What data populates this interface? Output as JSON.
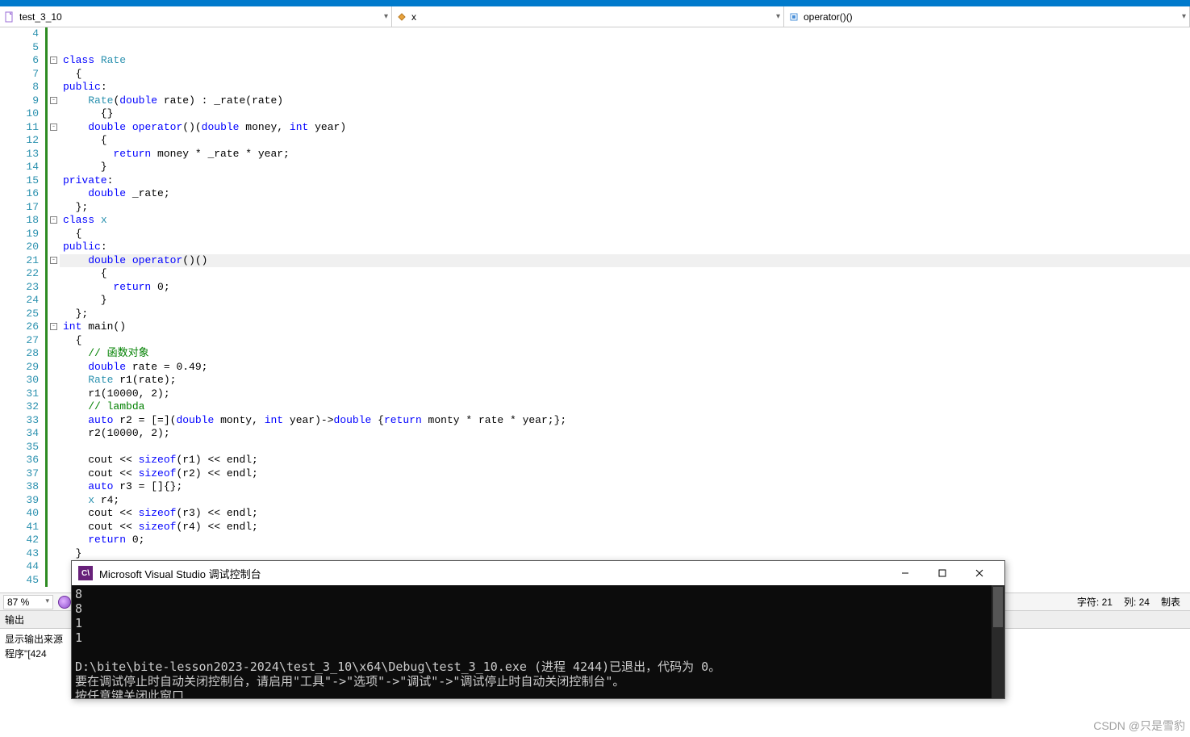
{
  "nav": {
    "scope1": "test_3_10",
    "scope2": "x",
    "scope3": "operator()()"
  },
  "editor": {
    "first_line": 4,
    "last_line": 45,
    "current_line": 21,
    "fold_lines": [
      6,
      9,
      11,
      18,
      21,
      26
    ],
    "change_bar_start": 4,
    "change_bar_end": 45,
    "code": {
      "4": [],
      "5": [],
      "6": [
        [
          "kw",
          "class"
        ],
        [
          " "
        ],
        [
          "type",
          "Rate"
        ]
      ],
      "7": [
        [
          "  {"
        ]
      ],
      "8": [
        [
          "kw",
          "public"
        ],
        [
          ":"
        ]
      ],
      "9": [
        [
          "    "
        ],
        [
          "type",
          "Rate"
        ],
        [
          "("
        ],
        [
          "kw",
          "double"
        ],
        [
          " rate) : _rate(rate)"
        ]
      ],
      "10": [
        [
          "      {}"
        ]
      ],
      "11": [
        [
          "    "
        ],
        [
          "kw",
          "double"
        ],
        [
          " "
        ],
        [
          "kw",
          "operator"
        ],
        [
          "()("
        ],
        [
          "kw",
          "double"
        ],
        [
          " money, "
        ],
        [
          "kw",
          "int"
        ],
        [
          " year)"
        ]
      ],
      "12": [
        [
          "      {"
        ]
      ],
      "13": [
        [
          "        "
        ],
        [
          "kw",
          "return"
        ],
        [
          " money * _rate * year;"
        ]
      ],
      "14": [
        [
          "      }"
        ]
      ],
      "15": [
        [
          "kw",
          "private"
        ],
        [
          ":"
        ]
      ],
      "16": [
        [
          "    "
        ],
        [
          "kw",
          "double"
        ],
        [
          " _rate;"
        ]
      ],
      "17": [
        [
          "  };"
        ]
      ],
      "18": [
        [
          "kw",
          "class"
        ],
        [
          " "
        ],
        [
          "type",
          "x"
        ]
      ],
      "19": [
        [
          "  {"
        ]
      ],
      "20": [
        [
          "kw",
          "public"
        ],
        [
          ":"
        ]
      ],
      "21": [
        [
          "    "
        ],
        [
          "kw",
          "double"
        ],
        [
          " "
        ],
        [
          "kw",
          "operator"
        ],
        [
          "()()"
        ]
      ],
      "22": [
        [
          "      {"
        ]
      ],
      "23": [
        [
          "        "
        ],
        [
          "kw",
          "return"
        ],
        [
          " 0;"
        ]
      ],
      "24": [
        [
          "      }"
        ]
      ],
      "25": [
        [
          "  };"
        ]
      ],
      "26": [
        [
          "kw",
          "int"
        ],
        [
          " main()"
        ]
      ],
      "27": [
        [
          "  {"
        ]
      ],
      "28": [
        [
          "    "
        ],
        [
          "cm",
          "// 函数对象"
        ]
      ],
      "29": [
        [
          "    "
        ],
        [
          "kw",
          "double"
        ],
        [
          " rate = 0.49;"
        ]
      ],
      "30": [
        [
          "    "
        ],
        [
          "type",
          "Rate"
        ],
        [
          " r1(rate);"
        ]
      ],
      "31": [
        [
          "    r1(10000, 2);"
        ]
      ],
      "32": [
        [
          "    "
        ],
        [
          "cm",
          "// lambda"
        ]
      ],
      "33": [
        [
          "    "
        ],
        [
          "kw",
          "auto"
        ],
        [
          " r2 = [=]("
        ],
        [
          "kw",
          "double"
        ],
        [
          " monty, "
        ],
        [
          "kw",
          "int"
        ],
        [
          " year)->"
        ],
        [
          "kw",
          "double"
        ],
        [
          " {"
        ],
        [
          "kw",
          "return"
        ],
        [
          " monty * rate * year;};"
        ]
      ],
      "34": [
        [
          "    r2(10000, 2);"
        ]
      ],
      "35": [],
      "36": [
        [
          "    cout << "
        ],
        [
          "kw",
          "sizeof"
        ],
        [
          "(r1) << endl;"
        ]
      ],
      "37": [
        [
          "    cout << "
        ],
        [
          "kw",
          "sizeof"
        ],
        [
          "(r2) << endl;"
        ]
      ],
      "38": [
        [
          "    "
        ],
        [
          "kw",
          "auto"
        ],
        [
          " r3 = []{};"
        ]
      ],
      "39": [
        [
          "    "
        ],
        [
          "type",
          "x"
        ],
        [
          " r4;"
        ]
      ],
      "40": [
        [
          "    cout << "
        ],
        [
          "kw",
          "sizeof"
        ],
        [
          "(r3) << endl;"
        ]
      ],
      "41": [
        [
          "    cout << "
        ],
        [
          "kw",
          "sizeof"
        ],
        [
          "(r4) << endl;"
        ]
      ],
      "42": [
        [
          "    "
        ],
        [
          "kw",
          "return"
        ],
        [
          " 0;"
        ]
      ],
      "43": [
        [
          "  }"
        ]
      ],
      "44": [],
      "45": []
    }
  },
  "zoom": "87 %",
  "status": {
    "char_label": "字符:",
    "char_val": "21",
    "col_label": "列:",
    "col_val": "24",
    "tabs": "制表"
  },
  "output": {
    "title": "输出",
    "source_label": "显示输出来源",
    "log_line": "程序\"[424"
  },
  "console": {
    "title": "Microsoft Visual Studio 调试控制台",
    "lines": [
      "8",
      "8",
      "1",
      "1",
      "",
      "D:\\bite\\bite-lesson2023-2024\\test_3_10\\x64\\Debug\\test_3_10.exe (进程 4244)已退出，代码为 0。",
      "要在调试停止时自动关闭控制台，请启用\"工具\"->\"选项\"->\"调试\"->\"调试停止时自动关闭控制台\"。",
      "按任意键关闭此窗口"
    ]
  },
  "watermark": "CSDN @只是雪豹"
}
